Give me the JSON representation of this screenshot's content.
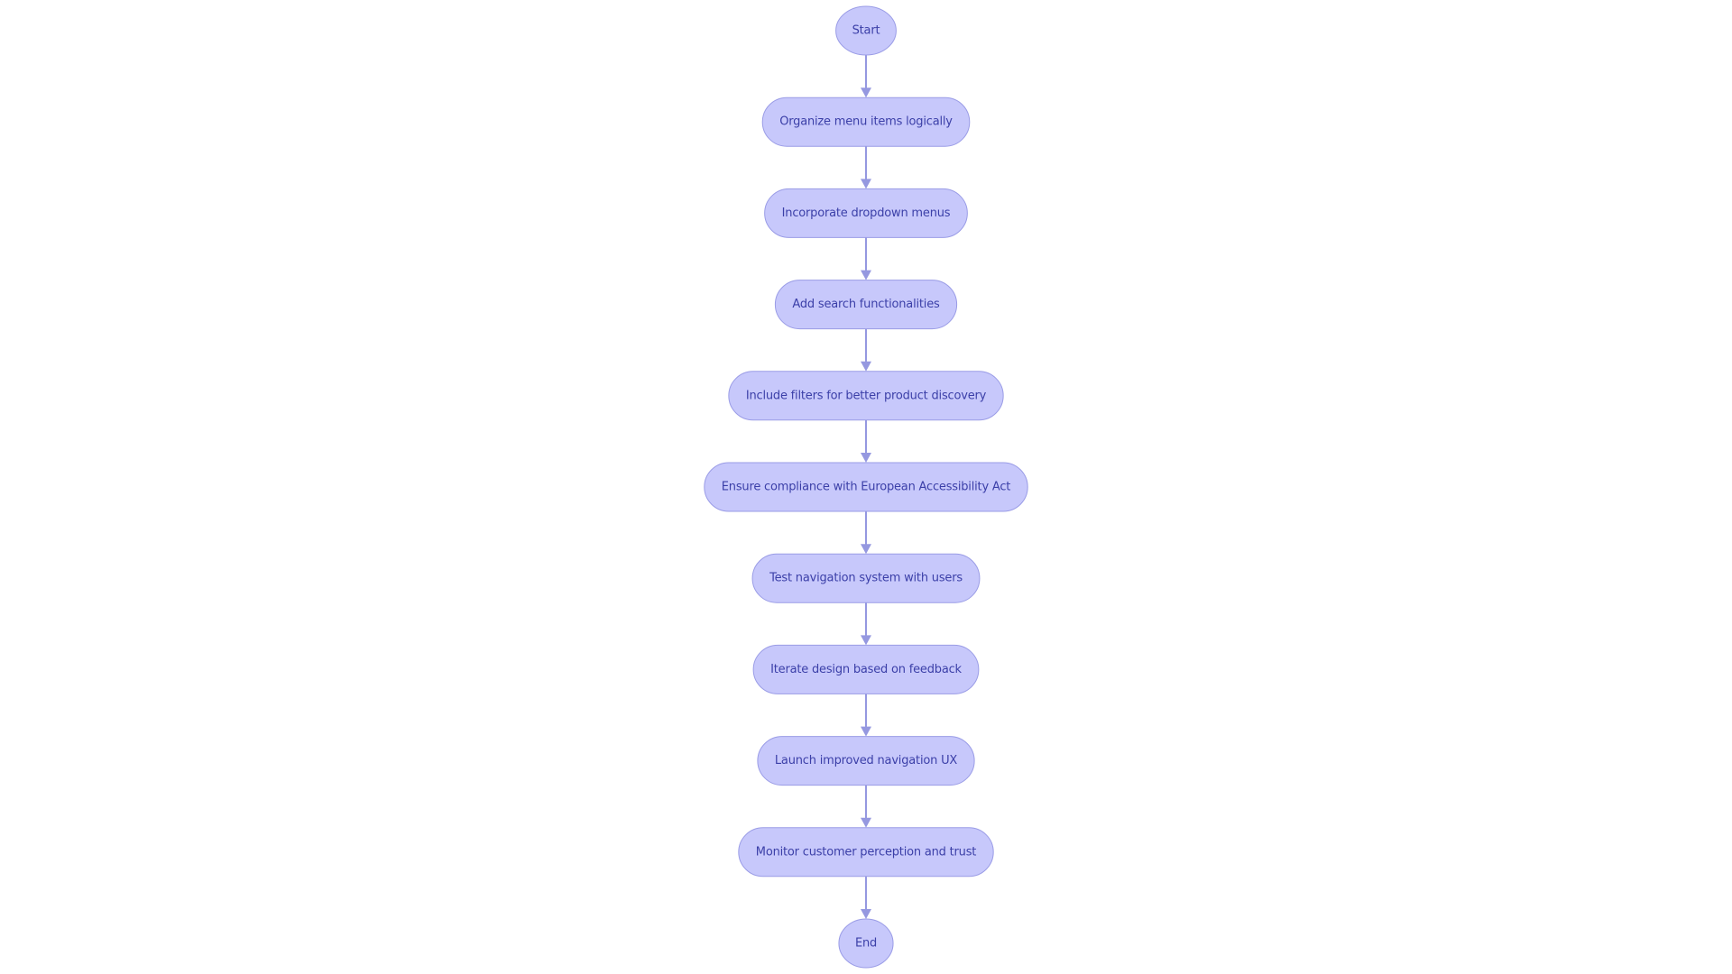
{
  "diagram": {
    "type": "flowchart",
    "direction": "top-to-bottom",
    "colors": {
      "node_fill": "#c7c8fb",
      "node_stroke": "#9a9ce6",
      "text": "#3b3fa8",
      "edge": "#9598e0",
      "background": "#ffffff"
    },
    "nodes": [
      {
        "id": "start",
        "label": "Start",
        "shape": "circle"
      },
      {
        "id": "n1",
        "label": "Organize menu items logically",
        "shape": "stadium"
      },
      {
        "id": "n2",
        "label": "Incorporate dropdown menus",
        "shape": "stadium"
      },
      {
        "id": "n3",
        "label": "Add search functionalities",
        "shape": "stadium"
      },
      {
        "id": "n4",
        "label": "Include filters for better product discovery",
        "shape": "stadium"
      },
      {
        "id": "n5",
        "label": "Ensure compliance with European Accessibility Act",
        "shape": "stadium"
      },
      {
        "id": "n6",
        "label": "Test navigation system with users",
        "shape": "stadium"
      },
      {
        "id": "n7",
        "label": "Iterate design based on feedback",
        "shape": "stadium"
      },
      {
        "id": "n8",
        "label": "Launch improved navigation UX",
        "shape": "stadium"
      },
      {
        "id": "n9",
        "label": "Monitor customer perception and trust",
        "shape": "stadium"
      },
      {
        "id": "end",
        "label": "End",
        "shape": "circle"
      }
    ],
    "edges": [
      {
        "from": "start",
        "to": "n1"
      },
      {
        "from": "n1",
        "to": "n2"
      },
      {
        "from": "n2",
        "to": "n3"
      },
      {
        "from": "n3",
        "to": "n4"
      },
      {
        "from": "n4",
        "to": "n5"
      },
      {
        "from": "n5",
        "to": "n6"
      },
      {
        "from": "n6",
        "to": "n7"
      },
      {
        "from": "n7",
        "to": "n8"
      },
      {
        "from": "n8",
        "to": "n9"
      },
      {
        "from": "n9",
        "to": "end"
      }
    ]
  }
}
